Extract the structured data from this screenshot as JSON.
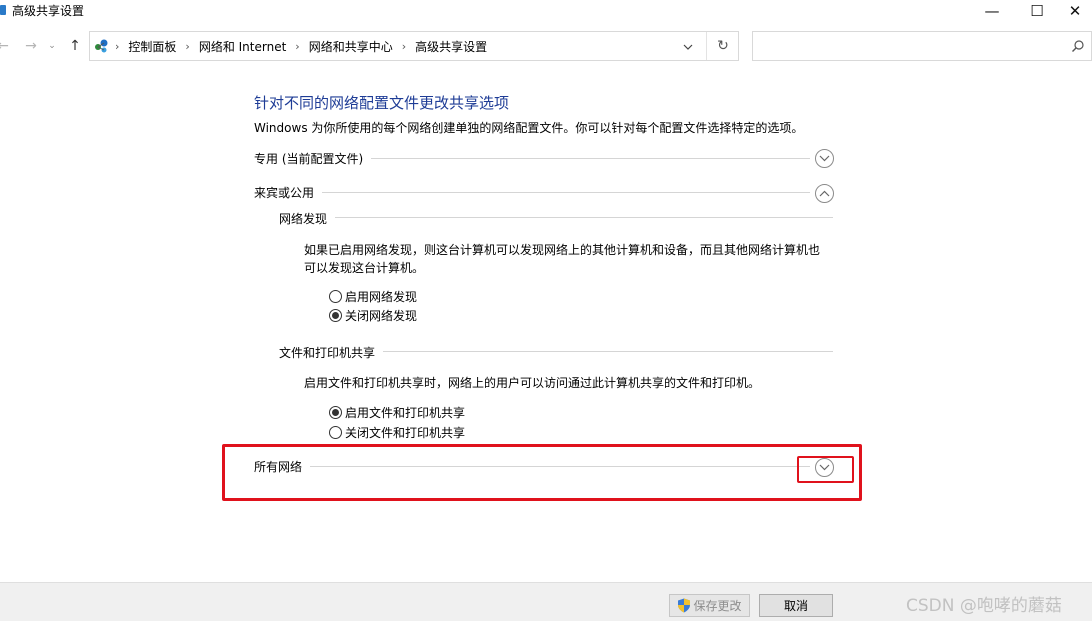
{
  "window": {
    "title": "高级共享设置",
    "minimize": "—",
    "maximize": "☐",
    "close": "✕"
  },
  "nav": {
    "back_icon": "arrow-left-icon",
    "forward_icon": "arrow-right-icon",
    "up_icon": "arrow-up-icon",
    "breadcrumbs": [
      "控制面板",
      "网络和 Internet",
      "网络和共享中心",
      "高级共享设置"
    ],
    "search_placeholder": ""
  },
  "page": {
    "heading": "针对不同的网络配置文件更改共享选项",
    "intro": "Windows 为你所使用的每个网络创建单独的网络配置文件。你可以针对每个配置文件选择特定的选项。"
  },
  "profiles": {
    "private": {
      "label": "专用 (当前配置文件)",
      "expanded": false
    },
    "guest": {
      "label": "来宾或公用",
      "expanded": true
    },
    "all": {
      "label": "所有网络",
      "expanded": false
    }
  },
  "network_discovery": {
    "title": "网络发现",
    "description": "如果已启用网络发现，则这台计算机可以发现网络上的其他计算机和设备，而且其他网络计算机也可以发现这台计算机。",
    "options": [
      {
        "label": "启用网络发现",
        "selected": false
      },
      {
        "label": "关闭网络发现",
        "selected": true
      }
    ]
  },
  "file_printer_sharing": {
    "title": "文件和打印机共享",
    "description": "启用文件和打印机共享时，网络上的用户可以访问通过此计算机共享的文件和打印机。",
    "options": [
      {
        "label": "启用文件和打印机共享",
        "selected": true
      },
      {
        "label": "关闭文件和打印机共享",
        "selected": false
      }
    ]
  },
  "footer": {
    "save_label": "保存更改",
    "cancel_label": "取消",
    "watermark": "CSDN @咆哮的蘑菇"
  },
  "colors": {
    "heading": "#1e3c96",
    "highlight": "#e0121c",
    "footer_bg": "#f0f0f0"
  }
}
